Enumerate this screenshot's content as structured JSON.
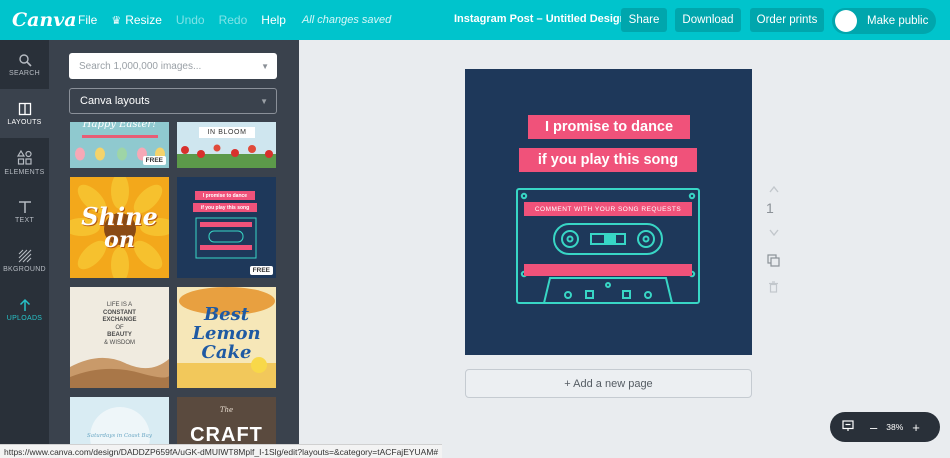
{
  "app": {
    "logo": "Canva"
  },
  "topbar": {
    "menu": [
      {
        "label": "File",
        "enabled": true
      },
      {
        "label": "Resize",
        "enabled": true
      },
      {
        "label": "Undo",
        "enabled": false
      },
      {
        "label": "Redo",
        "enabled": false
      },
      {
        "label": "Help",
        "enabled": true
      }
    ],
    "saved_status": "All changes saved",
    "doc_title": "Instagram Post – Untitled Design",
    "share_label": "Share",
    "download_label": "Download",
    "order_prints_label": "Order prints",
    "make_public_label": "Make public"
  },
  "rail": [
    {
      "label": "SEARCH",
      "icon": "search-icon"
    },
    {
      "label": "LAYOUTS",
      "icon": "layouts-icon",
      "active": true
    },
    {
      "label": "ELEMENTS",
      "icon": "elements-icon"
    },
    {
      "label": "TEXT",
      "icon": "text-icon"
    },
    {
      "label": "BKGROUND",
      "icon": "background-icon"
    },
    {
      "label": "UPLOADS",
      "icon": "upload-icon"
    }
  ],
  "panel": {
    "search_placeholder": "Search 1,000,000 images...",
    "select_value": "Canva layouts",
    "thumbs": {
      "easter": {
        "title": "Happy Easter!",
        "badge": "FREE"
      },
      "bloom": {
        "title": "IN BLOOM"
      },
      "shine": {
        "title_1": "Shine",
        "title_2": "on"
      },
      "promise": {
        "line_1": "I promise to dance",
        "line_2": "if you play this song",
        "badge": "FREE"
      },
      "life": {
        "line_1": "LIFE IS A",
        "line_2": "CONSTANT",
        "line_3": "EXCHANGE",
        "line_4": "OF",
        "line_5": "BEAUTY",
        "line_6": "& WISDOM"
      },
      "lemon": {
        "line_1": "Best",
        "line_2": "Lemon",
        "line_3": "Cake"
      },
      "craft": {
        "line_1": "The",
        "line_2": "CRAFT"
      },
      "saturday": {
        "line_1": "Saturdays in Coast Bay"
      }
    }
  },
  "design": {
    "line_1": "I promise to dance",
    "line_2": "if you play this song",
    "cassette_label": "COMMENT WITH YOUR SONG REQUESTS",
    "background": "#1e385a",
    "accent": "#f0527a",
    "line_color": "#38d6c5"
  },
  "canvas": {
    "add_page_label": "+ Add a new page",
    "page_number": "1"
  },
  "zoom": {
    "level": "38%",
    "minus": "–",
    "plus": "+"
  },
  "status_bar": {
    "url": "https://www.canva.com/design/DADDZP659fA/uGK-dMUIWT8Mplf_I-1Slg/edit?layouts=&category=tACFajEYUAM#"
  }
}
